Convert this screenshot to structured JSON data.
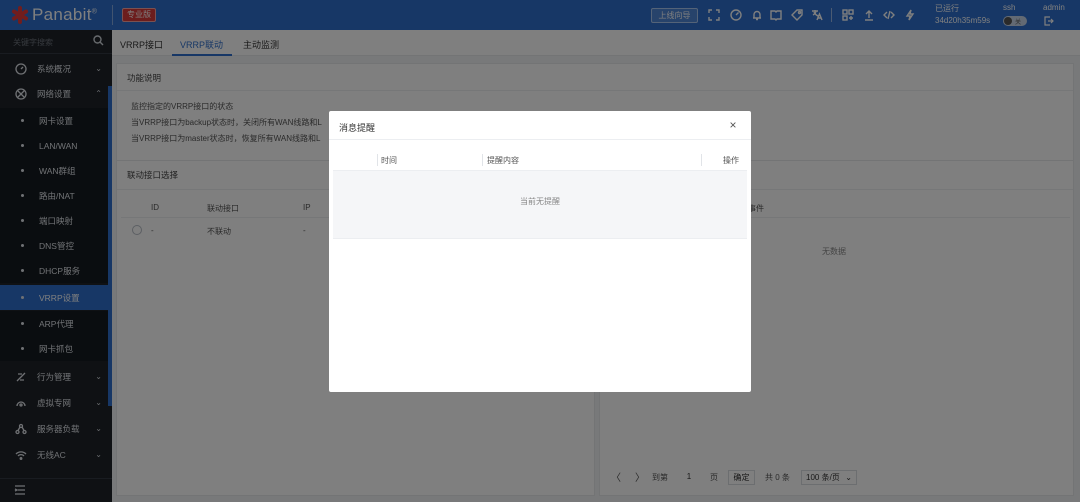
{
  "header": {
    "logo_text": "Panabit",
    "logo_reg": "®",
    "edition_badge": "专业版",
    "online_guide_button": "上线向导",
    "uptime_label": "已运行",
    "uptime_value": "34d20h35m59s",
    "ssh_label": "ssh",
    "ssh_toggle_text": "关",
    "user_label": "admin",
    "icons": [
      "fullscreen-icon",
      "dashboard-icon",
      "bell-icon",
      "book-icon",
      "tag-icon",
      "translate-icon",
      "grid-icon",
      "upload-icon",
      "code-icon",
      "bolt-icon"
    ]
  },
  "sidebar": {
    "search_placeholder": "关键字搜索",
    "groups": [
      {
        "label": "系统概况",
        "icon": "gauge-icon"
      },
      {
        "label": "网络设置",
        "icon": "network-icon"
      }
    ],
    "sub_items": [
      {
        "label": "网卡设置"
      },
      {
        "label": "LAN/WAN"
      },
      {
        "label": "WAN群组"
      },
      {
        "label": "路由/NAT"
      },
      {
        "label": "端口映射"
      },
      {
        "label": "DNS管控"
      },
      {
        "label": "DHCP服务"
      },
      {
        "label": "VRRP设置",
        "active": true
      },
      {
        "label": "ARP代理"
      },
      {
        "label": "网卡抓包"
      }
    ],
    "groups_after": [
      {
        "label": "行为管理",
        "icon": "behavior-icon"
      },
      {
        "label": "虚拟专网",
        "icon": "vpn-icon"
      },
      {
        "label": "服务器负载",
        "icon": "server-load-icon"
      },
      {
        "label": "无线AC",
        "icon": "wifi-icon"
      }
    ]
  },
  "tabs": [
    {
      "label": "VRRP接口"
    },
    {
      "label": "VRRP联动",
      "active": true
    },
    {
      "label": "主动监测"
    }
  ],
  "function_panel": {
    "title": "功能说明",
    "lines": [
      "监控指定的VRRP接口的状态",
      "当VRRP接口为backup状态时，关闭所有WAN线路和L",
      "当VRRP接口为master状态时，恢复所有WAN线路和L"
    ]
  },
  "link_panel": {
    "title": "联动接口选择",
    "columns": [
      "ID",
      "联动接口",
      "IP"
    ],
    "rows": [
      {
        "id": "-",
        "iface": "不联动",
        "ip": "-"
      }
    ]
  },
  "event_panel": {
    "column": "事件",
    "empty_text": "无数据"
  },
  "pagination": {
    "prev": "〈",
    "next": "〉",
    "goto_label": "到第",
    "page_value": "1",
    "page_unit": "页",
    "confirm": "确定",
    "total": "共 0 条",
    "page_size": "100 条/页"
  },
  "modal": {
    "title": "消息提醒",
    "close": "×",
    "columns": [
      "时间",
      "提醒内容",
      "操作"
    ],
    "empty_text": "当前无提醒"
  }
}
